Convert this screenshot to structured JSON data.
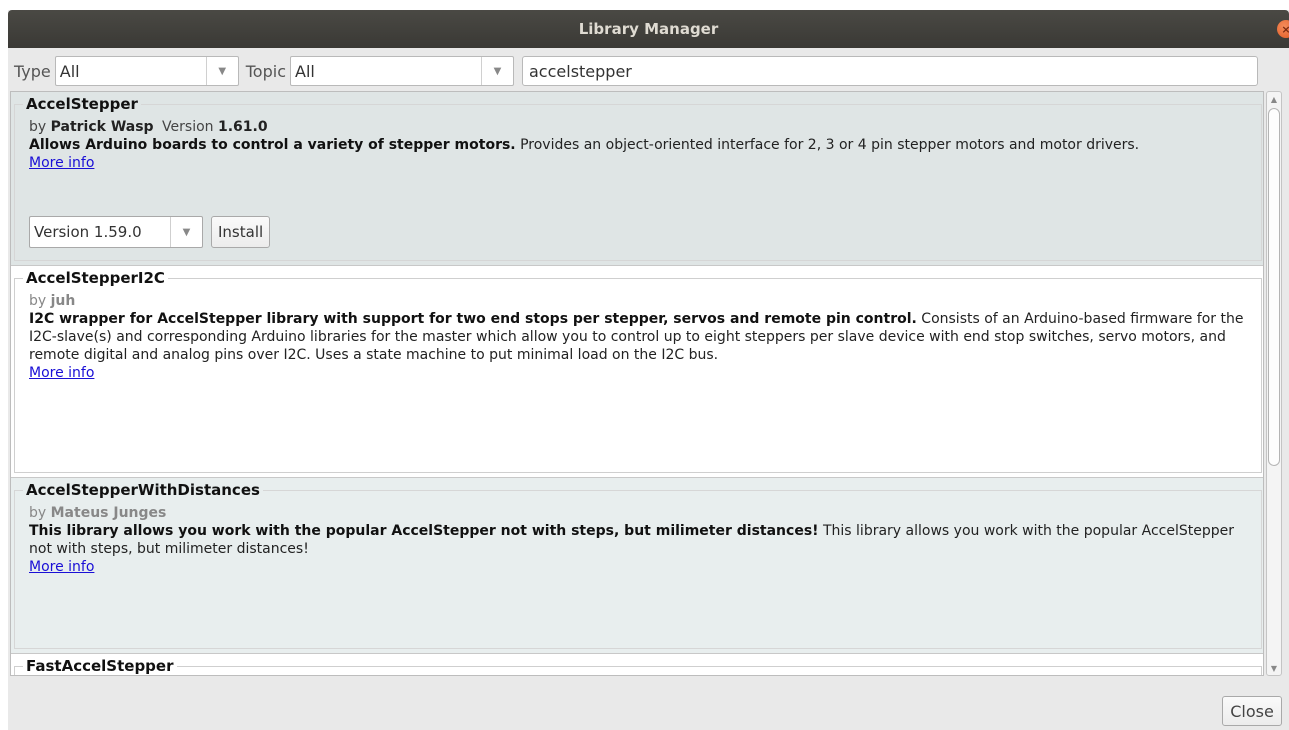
{
  "window": {
    "title": "Library Manager",
    "close_glyph": "×"
  },
  "filters": {
    "type_label": "Type",
    "type_value": "All",
    "topic_label": "Topic",
    "topic_value": "All",
    "search_value": "accelstepper",
    "dropdown_glyph": "▼"
  },
  "libraries": [
    {
      "name": "AccelStepper",
      "by_prefix": "by",
      "author": "Patrick Wasp",
      "version_label": "Version",
      "version": "1.61.0",
      "summary": "Allows Arduino boards to control a variety of stepper motors.",
      "details": "Provides an object-oriented interface for 2, 3 or 4 pin stepper motors and motor drivers.",
      "more_info": "More info",
      "selected_version": "Version 1.59.0",
      "install_label": "Install"
    },
    {
      "name": "AccelStepperI2C",
      "by_prefix": "by",
      "author": "juh",
      "summary": "I2C wrapper for AccelStepper library with support for two end stops per stepper, servos and remote pin control.",
      "details": "Consists of an Arduino-based firmware for the I2C-slave(s) and corresponding Arduino libraries for the master which allow you to control up to eight steppers per slave device with end stop switches, servo motors, and remote digital and analog pins over I2C. Uses a state machine to put minimal load on the I2C bus.",
      "more_info": "More info"
    },
    {
      "name": "AccelStepperWithDistances",
      "by_prefix": "by",
      "author": "Mateus Junges",
      "summary": "This library allows you work with the popular AccelStepper not with steps, but milimeter distances!",
      "details": "This library allows you work with the popular AccelStepper not with steps, but milimeter distances!",
      "more_info": "More info"
    },
    {
      "name": "FastAccelStepper"
    }
  ],
  "footer": {
    "close_label": "Close"
  },
  "colors": {
    "titlebar": "#3d3c38",
    "link": "#1a0fd6",
    "selected_row": "#dfe5e5",
    "close_dot": "#e05a24"
  }
}
